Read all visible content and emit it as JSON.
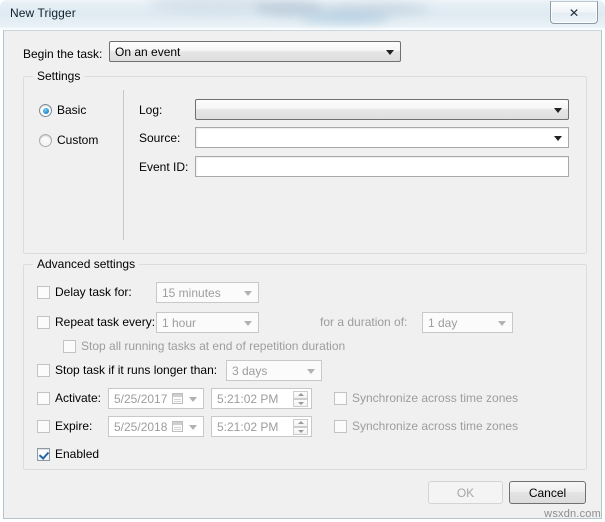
{
  "window": {
    "title": "New Trigger",
    "close_icon": "close-icon",
    "close_glyph": "✕"
  },
  "begin": {
    "label": "Begin the task:",
    "value": "On an event"
  },
  "settings": {
    "group_title": "Settings",
    "mode_basic": "Basic",
    "mode_custom": "Custom",
    "selected_mode": "Basic",
    "log": {
      "label": "Log:",
      "value": ""
    },
    "source": {
      "label": "Source:",
      "value": ""
    },
    "event_id": {
      "label": "Event ID:",
      "value": ""
    }
  },
  "advanced": {
    "group_title": "Advanced settings",
    "delay": {
      "label": "Delay task for:",
      "checked": false,
      "value": "15 minutes"
    },
    "repeat": {
      "label": "Repeat task every:",
      "checked": false,
      "value": "1 hour",
      "duration_label": "for a duration of:",
      "duration_value": "1 day"
    },
    "stop_at_end": {
      "label": "Stop all running tasks at end of repetition duration",
      "checked": false
    },
    "stop_longer": {
      "label": "Stop task if it runs longer than:",
      "checked": false,
      "value": "3 days"
    },
    "activate": {
      "label": "Activate:",
      "checked": false,
      "date": "5/25/2017",
      "time": "5:21:02 PM",
      "sync_label": "Synchronize across time zones",
      "sync_checked": false
    },
    "expire": {
      "label": "Expire:",
      "checked": false,
      "date": "5/25/2018",
      "time": "5:21:02 PM",
      "sync_label": "Synchronize across time zones",
      "sync_checked": false
    },
    "enabled": {
      "label": "Enabled",
      "checked": true
    }
  },
  "footer": {
    "ok_label": "OK",
    "cancel_label": "Cancel"
  },
  "watermark": "wsxdn.com",
  "colors": {
    "dialog_bg": "#f0f0f0",
    "accent_check": "#2668a8",
    "radio_accent": "#2e93d6",
    "disabled_text": "#9d9d9d"
  }
}
